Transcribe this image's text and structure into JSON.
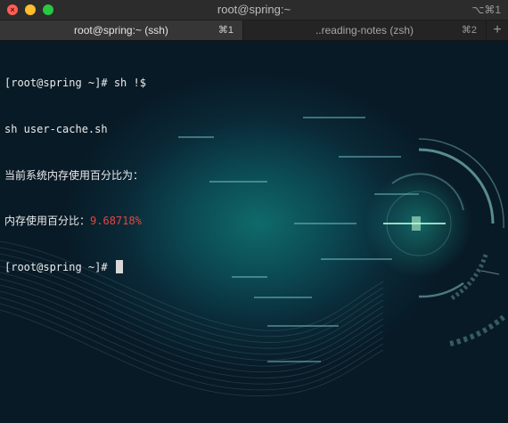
{
  "window": {
    "title": "root@spring:~",
    "shortcut": "⌥⌘1"
  },
  "tabs": [
    {
      "label": "root@spring:~ (ssh)",
      "shortcut": "⌘1",
      "active": true
    },
    {
      "label": "..reading-notes (zsh)",
      "shortcut": "⌘2",
      "active": false
    }
  ],
  "new_tab_label": "+",
  "terminal": {
    "line1": "[root@spring ~]# sh !$",
    "line2": "sh user-cache.sh",
    "line3": "当前系统内存使用百分比为：",
    "line4_label": "内存使用百分比：",
    "line4_value": "9.68718%",
    "line5": "[root@spring ~]#"
  },
  "colors": {
    "close": "#fe5f57",
    "minimize": "#febc2e",
    "maximize": "#28c840",
    "highlight_value": "#e8443f",
    "glow": "#0f6a6a"
  },
  "icons": [
    "close-icon",
    "minimize-icon",
    "maximize-icon",
    "plus-icon"
  ]
}
